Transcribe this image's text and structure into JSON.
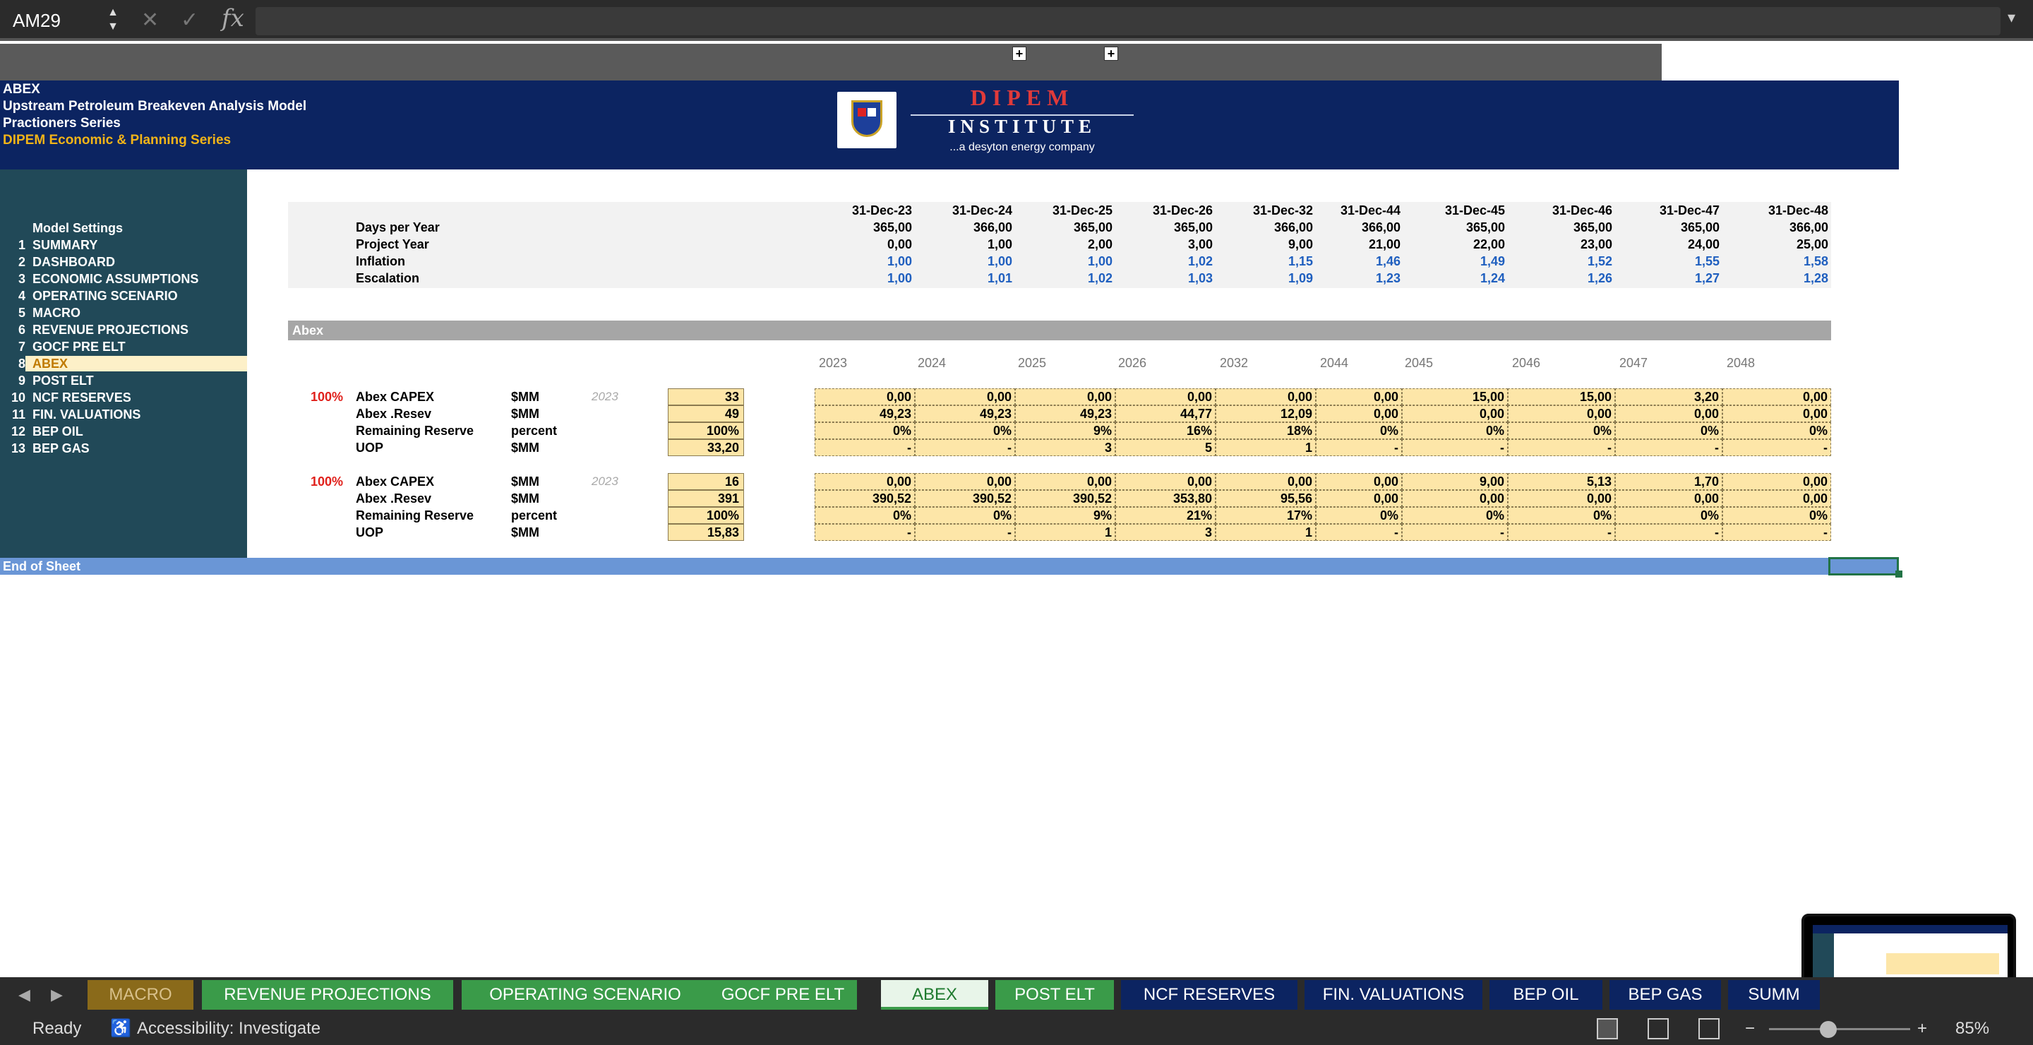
{
  "formula_bar": {
    "cell_ref": "AM29",
    "fx": "fx"
  },
  "header": {
    "line1": "ABEX",
    "line2": "Upstream Petroleum Breakeven Analysis Model",
    "line3": "Practioners Series",
    "line4": "DIPEM Economic & Planning Series",
    "logo_top": "DIPEM",
    "logo_bottom": "INSTITUTE",
    "tagline": "...a desyton energy company"
  },
  "sidebar": {
    "title": "Model Settings",
    "items": [
      {
        "num": "1",
        "label": "SUMMARY"
      },
      {
        "num": "2",
        "label": "DASHBOARD"
      },
      {
        "num": "3",
        "label": "ECONOMIC ASSUMPTIONS"
      },
      {
        "num": "4",
        "label": "OPERATING SCENARIO"
      },
      {
        "num": "5",
        "label": "MACRO"
      },
      {
        "num": "6",
        "label": "REVENUE PROJECTIONS"
      },
      {
        "num": "7",
        "label": "GOCF  PRE ELT"
      },
      {
        "num": "8",
        "label": "ABEX"
      },
      {
        "num": "9",
        "label": "POST ELT"
      },
      {
        "num": "10",
        "label": "NCF RESERVES"
      },
      {
        "num": "11",
        "label": "FIN. VALUATIONS"
      },
      {
        "num": "12",
        "label": "BEP OIL"
      },
      {
        "num": "13",
        "label": "BEP GAS"
      }
    ]
  },
  "timeline": {
    "dates": [
      "31-Dec-23",
      "31-Dec-24",
      "31-Dec-25",
      "31-Dec-26",
      "31-Dec-32",
      "31-Dec-44",
      "31-Dec-45",
      "31-Dec-46",
      "31-Dec-47",
      "31-Dec-48"
    ],
    "rows": [
      {
        "label": "Days per Year",
        "values": [
          "365,00",
          "366,00",
          "365,00",
          "365,00",
          "366,00",
          "366,00",
          "365,00",
          "365,00",
          "365,00",
          "366,00"
        ],
        "blue": false
      },
      {
        "label": "Project Year",
        "values": [
          "0,00",
          "1,00",
          "2,00",
          "3,00",
          "9,00",
          "21,00",
          "22,00",
          "23,00",
          "24,00",
          "25,00"
        ],
        "blue": false
      },
      {
        "label": "Inflation",
        "values": [
          "1,00",
          "1,00",
          "1,00",
          "1,02",
          "1,15",
          "1,46",
          "1,49",
          "1,52",
          "1,55",
          "1,58"
        ],
        "blue": true
      },
      {
        "label": "Escalation",
        "values": [
          "1,00",
          "1,01",
          "1,02",
          "1,03",
          "1,09",
          "1,23",
          "1,24",
          "1,26",
          "1,27",
          "1,28"
        ],
        "blue": true
      }
    ]
  },
  "section": {
    "title": "Abex",
    "years": [
      "2023",
      "2024",
      "2025",
      "2026",
      "2032",
      "2044",
      "2045",
      "2046",
      "2047",
      "2048"
    ]
  },
  "blocks": [
    {
      "pct": "100%",
      "year": "2023",
      "rows": [
        {
          "label": "Abex CAPEX",
          "unit": "$MM",
          "input": "33",
          "values": [
            "0,00",
            "0,00",
            "0,00",
            "0,00",
            "0,00",
            "0,00",
            "15,00",
            "15,00",
            "3,20",
            "0,00"
          ]
        },
        {
          "label": "Abex .Resev",
          "unit": "$MM",
          "input": "49",
          "values": [
            "49,23",
            "49,23",
            "49,23",
            "44,77",
            "12,09",
            "0,00",
            "0,00",
            "0,00",
            "0,00",
            "0,00"
          ]
        },
        {
          "label": "Remaining Reserve",
          "unit": "percent",
          "input": "100%",
          "values": [
            "0%",
            "0%",
            "9%",
            "16%",
            "18%",
            "0%",
            "0%",
            "0%",
            "0%",
            "0%"
          ]
        },
        {
          "label": "UOP",
          "unit": "$MM",
          "input": "33,20",
          "values": [
            "-",
            "-",
            "3",
            "5",
            "1",
            "-",
            "-",
            "-",
            "-",
            "-"
          ]
        }
      ]
    },
    {
      "pct": "100%",
      "year": "2023",
      "rows": [
        {
          "label": "Abex CAPEX",
          "unit": "$MM",
          "input": "16",
          "values": [
            "0,00",
            "0,00",
            "0,00",
            "0,00",
            "0,00",
            "0,00",
            "9,00",
            "5,13",
            "1,70",
            "0,00"
          ]
        },
        {
          "label": "Abex .Resev",
          "unit": "$MM",
          "input": "391",
          "values": [
            "390,52",
            "390,52",
            "390,52",
            "353,80",
            "95,56",
            "0,00",
            "0,00",
            "0,00",
            "0,00",
            "0,00"
          ]
        },
        {
          "label": "Remaining Reserve",
          "unit": "percent",
          "input": "100%",
          "values": [
            "0%",
            "0%",
            "9%",
            "21%",
            "17%",
            "0%",
            "0%",
            "0%",
            "0%",
            "0%"
          ]
        },
        {
          "label": "UOP",
          "unit": "$MM",
          "input": "15,83",
          "values": [
            "-",
            "-",
            "1",
            "3",
            "1",
            "-",
            "-",
            "-",
            "-",
            "-"
          ]
        }
      ]
    }
  ],
  "end_of_sheet": "End of Sheet",
  "tabs": [
    {
      "label": "MACRO",
      "style": "gold"
    },
    {
      "label": "REVENUE PROJECTIONS",
      "style": "green"
    },
    {
      "label": "OPERATING SCENARIO",
      "style": "green"
    },
    {
      "label": "GOCF  PRE ELT",
      "style": "green"
    },
    {
      "label": "ABEX",
      "style": "active"
    },
    {
      "label": "POST ELT",
      "style": "green"
    },
    {
      "label": "NCF RESERVES",
      "style": "navy"
    },
    {
      "label": "FIN. VALUATIONS",
      "style": "navy"
    },
    {
      "label": "BEP OIL",
      "style": "navy"
    },
    {
      "label": "BEP GAS",
      "style": "navy"
    },
    {
      "label": "SUMM",
      "style": "navy"
    }
  ],
  "status": {
    "ready": "Ready",
    "accessibility": "Accessibility: Investigate",
    "zoom": "85%"
  },
  "colors": {
    "header_navy": "#0c2461",
    "sidebar_teal": "#214958",
    "input_yellow": "#fde6a8",
    "tab_green": "#3a9b49",
    "accent_red": "#e0201b"
  }
}
